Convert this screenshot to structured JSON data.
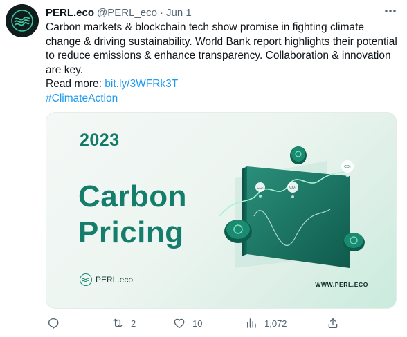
{
  "tweet": {
    "display_name": "PERL.eco",
    "handle": "@PERL_eco",
    "separator": "·",
    "date": "Jun 1",
    "text_line1": "Carbon markets & blockchain tech show promise in fighting climate change & driving sustainability. World Bank report highlights their potential to reduce emissions & enhance transparency. Collaboration & innovation are key.",
    "read_more_label": "Read more:",
    "link_text": "bit.ly/3WFRk3T",
    "hashtag": "#ClimateAction"
  },
  "media": {
    "year": "2023",
    "headline_line1": "Carbon",
    "headline_line2": "Pricing",
    "brand_name": "PERL.eco",
    "site": "WWW.PERL.ECO",
    "bubble_labels": [
      "CO₂",
      "CO₂",
      "CO₂"
    ]
  },
  "actions": {
    "reply_icon": "reply-icon",
    "retweet_icon": "retweet-icon",
    "retweet_count": "2",
    "like_icon": "heart-icon",
    "like_count": "10",
    "views_icon": "views-icon",
    "views_count": "1,072",
    "share_icon": "share-icon"
  },
  "colors": {
    "accent_link": "#1d9bf0",
    "text_primary": "#0f1419",
    "text_secondary": "#536471",
    "brand_green": "#157d6c"
  }
}
